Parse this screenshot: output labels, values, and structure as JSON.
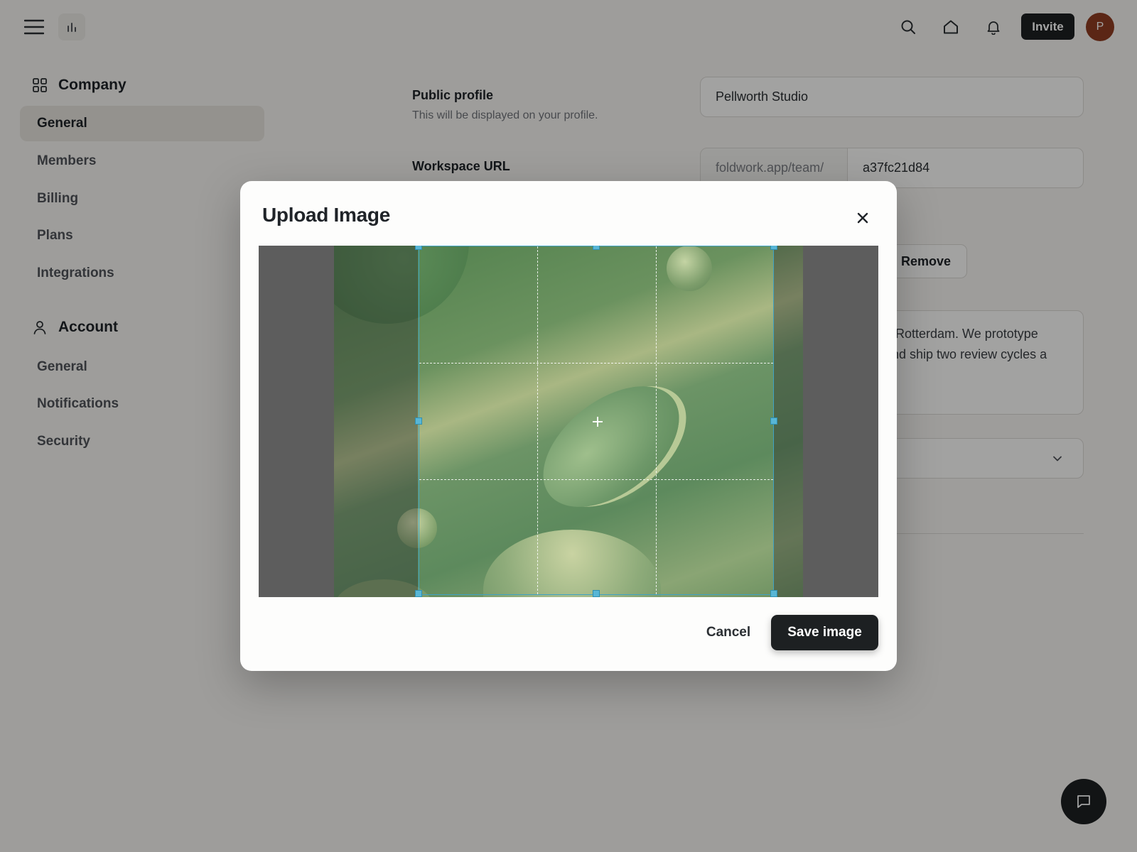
{
  "topbar": {
    "menu_icon": "hamburger-menu-icon",
    "logo_icon": "bar-chart-icon",
    "icons": [
      "search-icon",
      "home-icon",
      "bell-icon"
    ],
    "invite_label": "Invite",
    "avatar_initial": "P",
    "avatar_color": "#8f3c22"
  },
  "sidebar": {
    "company": {
      "heading": "Company",
      "icon": "grid-icon",
      "items": [
        {
          "label": "General",
          "active": true
        },
        {
          "label": "Members"
        },
        {
          "label": "Billing"
        },
        {
          "label": "Plans"
        },
        {
          "label": "Integrations"
        }
      ]
    },
    "account": {
      "heading": "Account",
      "icon": "user-icon",
      "items": [
        {
          "label": "General"
        },
        {
          "label": "Notifications"
        },
        {
          "label": "Security"
        }
      ]
    }
  },
  "form": {
    "public_profile": {
      "label": "Public profile",
      "hint": "This will be displayed on your profile.",
      "value": "Pellworth Studio"
    },
    "workspace_url": {
      "label": "Workspace URL",
      "prefix": "foldwork.app/team/",
      "value": "a37fc21d84"
    },
    "remove_label": "Remove",
    "bio_lines": [
      "n Rotterdam. We prototype",
      "and ship two review cycles a"
    ]
  },
  "modal": {
    "title": "Upload Image",
    "cancel_label": "Cancel",
    "save_label": "Save image",
    "crop_accent": "#3fa3c4"
  },
  "chat_icon": "chat-bubble-icon",
  "colors": {
    "primary_dark": "#1d2022",
    "sidebar_active": "#e8e5df"
  }
}
